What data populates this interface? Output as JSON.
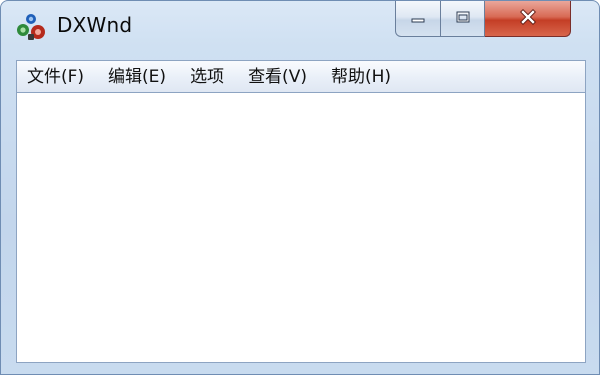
{
  "window": {
    "title": "DXWnd",
    "icon": "dxwnd-app-icon"
  },
  "caption_buttons": {
    "minimize_icon": "minimize-icon",
    "maximize_icon": "maximize-icon",
    "close_icon": "close-icon"
  },
  "menu": {
    "items": [
      {
        "label": "文件(F)"
      },
      {
        "label": "编辑(E)"
      },
      {
        "label": "选项"
      },
      {
        "label": "查看(V)"
      },
      {
        "label": "帮助(H)"
      }
    ]
  },
  "colors": {
    "frame": "#c3d6ec",
    "close_button": "#c43e26",
    "client_background": "#ffffff"
  }
}
